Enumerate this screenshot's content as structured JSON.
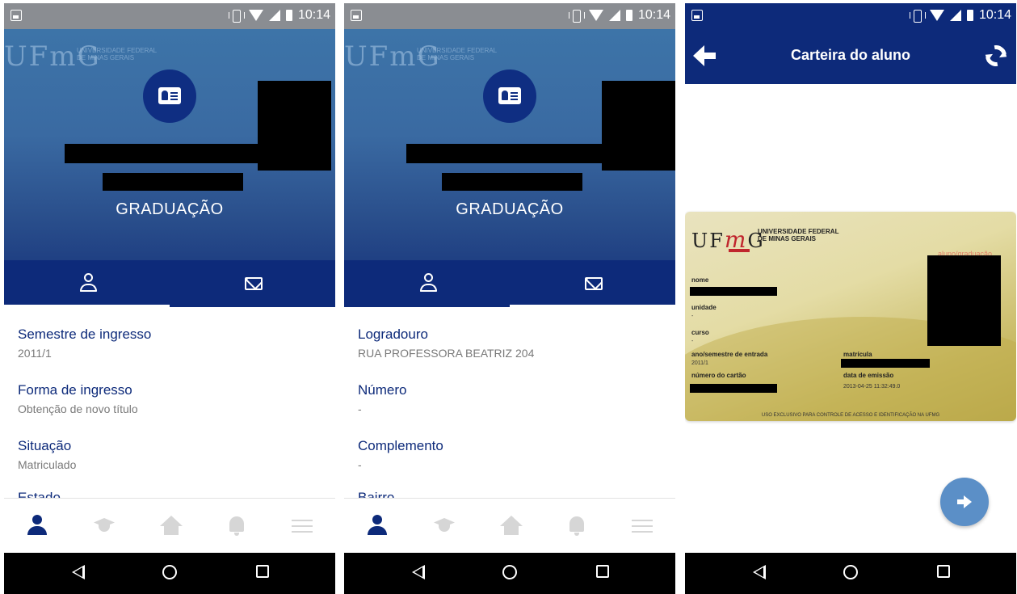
{
  "status_bar": {
    "time": "10:14"
  },
  "profile": {
    "category": "GRADUAÇÃO",
    "card_background": {
      "logo": "UFmG",
      "univ_line1": "UNIVERSIDADE FEDERAL",
      "univ_line2": "DE MINAS GERAIS"
    },
    "tabs": [
      {
        "name": "person-icon"
      },
      {
        "name": "mail-icon"
      }
    ]
  },
  "screen1": {
    "fields": [
      {
        "label": "Semestre de ingresso",
        "value": "2011/1"
      },
      {
        "label": "Forma de ingresso",
        "value": "Obtenção de novo título"
      },
      {
        "label": "Situação",
        "value": "Matriculado"
      },
      {
        "label": "Estado",
        "value": ""
      }
    ]
  },
  "screen2": {
    "fields": [
      {
        "label": "Logradouro",
        "value": "RUA PROFESSORA BEATRIZ 204"
      },
      {
        "label": "Número",
        "value": "-"
      },
      {
        "label": "Complemento",
        "value": "-"
      },
      {
        "label": "Bairro",
        "value": ""
      }
    ]
  },
  "bottom_nav": [
    "person-icon",
    "graduation-cap-icon",
    "home-icon",
    "bell-icon",
    "menu-icon"
  ],
  "screen3": {
    "title": "Carteira do aluno",
    "card": {
      "logo_u": "UF",
      "logo_m": "m",
      "logo_g": "G",
      "univ_line1": "UNIVERSIDADE FEDERAL",
      "univ_line2": "DE MINAS GERAIS",
      "tag": "aluno/graduação",
      "nome_label": "nome",
      "unidade_label": "unidade",
      "unidade_value": "-",
      "curso_label": "curso",
      "curso_value": "-",
      "ano_label": "ano/semestre de entrada",
      "ano_value": "2011/1",
      "matricula_label": "matrícula",
      "numero_label": "número do cartão",
      "emissao_label": "data de emissão",
      "emissao_value": "2013-04-25 11:32:49.0",
      "footer": "USO EXCLUSIVO PARA CONTROLE DE ACESSO E IDENTIFICAÇÃO NA UFMG"
    }
  },
  "colors": {
    "primary": "#0d2a7a",
    "fab": "#5b8fc7",
    "field_label": "#0d2a7a",
    "field_value": "#7a7a7a"
  }
}
